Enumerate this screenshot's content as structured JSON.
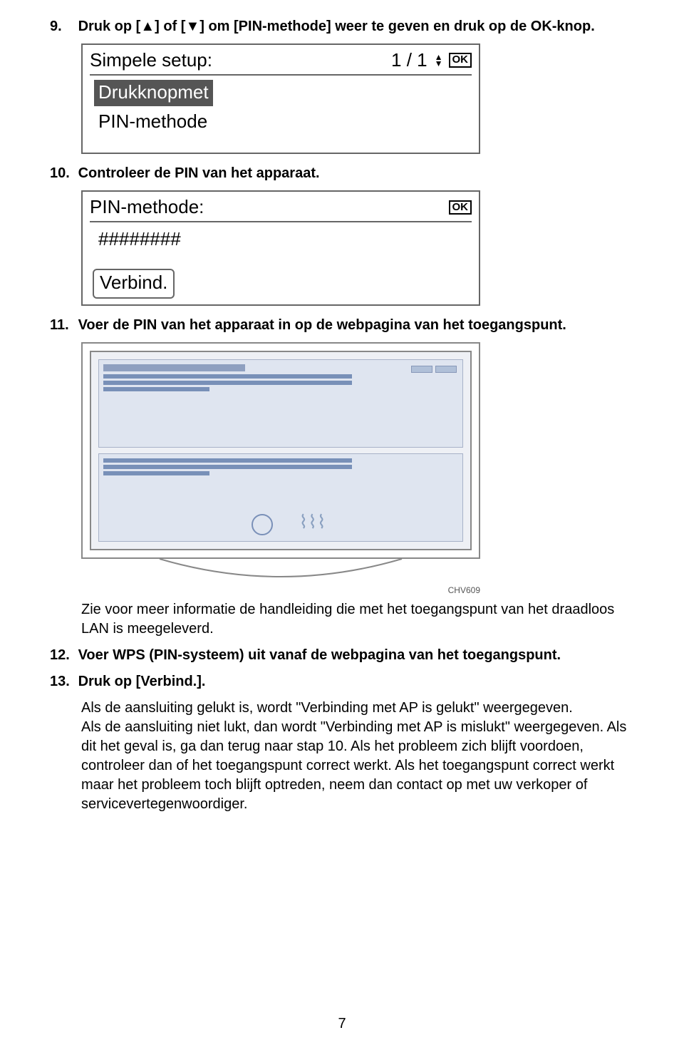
{
  "step9": {
    "num": "9.",
    "text_pre": "Druk op [",
    "tri_up": "▲",
    "text_mid1": "] of [",
    "tri_down": "▼",
    "text_mid2": "] om [PIN-methode] weer te geven en druk op de OK-knop."
  },
  "lcd1": {
    "title": "Simpele setup:",
    "page": "1 / 1",
    "arrow_up": "▲",
    "arrow_down": "▼",
    "ok": "OK",
    "item_selected": "Drukknopmet",
    "item2": "PIN-methode"
  },
  "step10": {
    "num": "10.",
    "text": "Controleer de PIN van het apparaat."
  },
  "lcd2": {
    "title": "PIN-methode:",
    "ok": "OK",
    "hash": "########",
    "btn": "Verbind."
  },
  "step11": {
    "num": "11.",
    "text": "Voer de PIN van het apparaat in op de webpagina van het toegangspunt."
  },
  "figcode": "CHV609",
  "note11": "Zie voor meer informatie de handleiding die met het toegangspunt van het draadloos LAN is meegeleverd.",
  "step12": {
    "num": "12.",
    "text": "Voer WPS (PIN-systeem) uit vanaf de webpagina van het toegangspunt."
  },
  "step13": {
    "num": "13.",
    "text": "Druk op [Verbind.]."
  },
  "para13": "Als de aansluiting gelukt is, wordt \"Verbinding met AP is gelukt\" weergegeven.\nAls de aansluiting niet lukt, dan wordt \"Verbinding met AP is mislukt\" weergegeven. Als dit het geval is, ga dan terug naar stap 10. Als het probleem zich blijft voordoen, controleer dan of het toegangspunt correct werkt. Als het toegangspunt correct werkt maar het probleem toch blijft optreden, neem dan contact op met uw verkoper of servicevertegenwoordiger.",
  "pagenum": "7"
}
